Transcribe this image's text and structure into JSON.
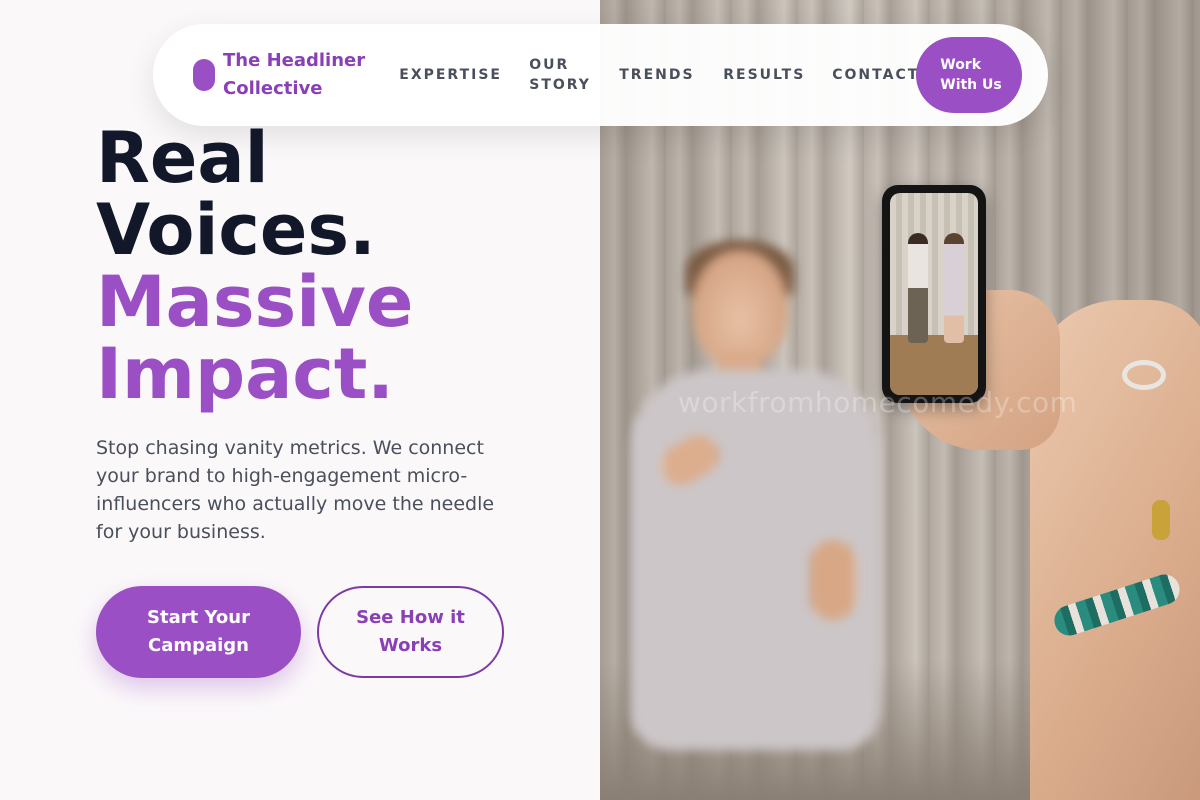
{
  "brand": {
    "name": "The Headliner Collective"
  },
  "nav": {
    "links": [
      "EXPERTISE",
      "OUR STORY",
      "TRENDS",
      "RESULTS",
      "CONTACT"
    ],
    "cta_label": "Work With Us"
  },
  "hero": {
    "headline_dark_1": "Real",
    "headline_dark_2": "Voices.",
    "headline_accent_1": "Massive",
    "headline_accent_2": "Impact.",
    "subtext": "Stop chasing vanity metrics. We connect your brand to high-engagement micro-influencers who actually move the needle for your business.",
    "primary_button": "Start Your Campaign",
    "secondary_button": "See How it Works"
  },
  "image": {
    "watermark_text": "workfromhomecomedy.com"
  },
  "colors": {
    "accent": "#9b4fc4",
    "heading_dark": "#121829",
    "body_text": "#4a4f5c",
    "background": "#fbf8fa"
  },
  "icons": {
    "brand_mark": "rounded-pill-logo"
  }
}
